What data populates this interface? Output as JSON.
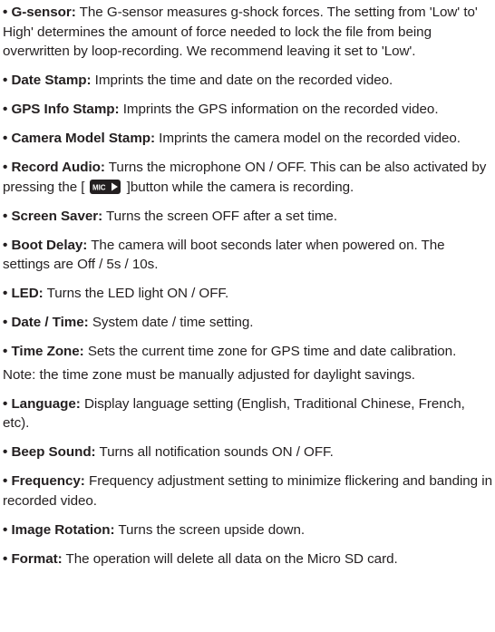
{
  "bullet": "•",
  "items": [
    {
      "term": "G-sensor:",
      "text": " The G-sensor measures g-shock forces. The setting from 'Low' to' High' determines the amount of force needed to lock the file from being overwritten by loop-recording. We recommend leaving it set to 'Low'."
    },
    {
      "term": "Date Stamp:",
      "text": " Imprints the time and date on the recorded video."
    },
    {
      "term": "GPS Info Stamp:",
      "text": " Imprints the GPS information on the recorded video."
    },
    {
      "term": "Camera Model Stamp:",
      "text": " Imprints the camera model on the recorded video."
    },
    {
      "term": "Record Audio:",
      "text_before": " Turns the microphone ON / OFF. This can be also activated by pressing the [",
      "icon": "mic-button-icon",
      "icon_label": "MIC",
      "text_after": " ]button while the camera is recording."
    },
    {
      "term": "Screen Saver:",
      "text": " Turns the screen OFF after a set time."
    },
    {
      "term": "Boot Delay:",
      "text": " The camera will boot seconds later when powered on. The settings are Off / 5s / 10s."
    },
    {
      "term": "LED:",
      "text": " Turns the LED light ON / OFF."
    },
    {
      "term": "Date / Time:",
      "text": " System date / time setting."
    },
    {
      "term": "Time Zone:",
      "text": " Sets the current time zone for GPS time and date calibration."
    },
    {
      "term": "Language:",
      "text": " Display language setting (English, Traditional Chinese, French, etc)."
    },
    {
      "term": "Beep Sound:",
      "text": " Turns all notification sounds ON / OFF."
    },
    {
      "term": "Frequency:",
      "text": " Frequency adjustment setting to minimize flickering and banding in recorded video."
    },
    {
      "term": "Image Rotation:",
      "text": " Turns the screen upside down."
    },
    {
      "term": "Format:",
      "text": " The operation will delete all data on the Micro SD card."
    }
  ],
  "note": "Note: the time zone must be manually adjusted for daylight savings.",
  "colors": {
    "text": "#231f20",
    "icon_bg": "#231f20",
    "icon_fg": "#ffffff"
  }
}
